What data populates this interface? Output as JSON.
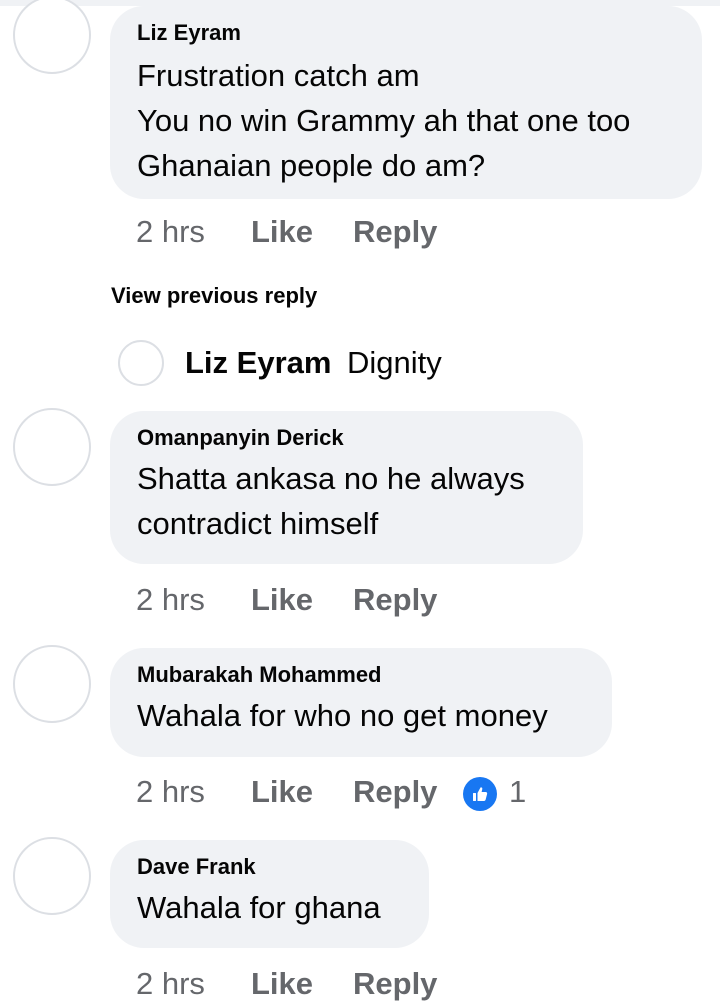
{
  "comments": [
    {
      "author": "Liz Eyram",
      "lines": [
        "Frustration catch am",
        "You no win Grammy ah that one too",
        "Ghanaian people do am?"
      ],
      "time": "2 hrs",
      "like_label": "Like",
      "reply_label": "Reply"
    },
    {
      "author": "Omanpanyin Derick",
      "lines": [
        "Shatta ankasa no he always",
        "contradict himself"
      ],
      "time": "2 hrs",
      "like_label": "Like",
      "reply_label": "Reply"
    },
    {
      "author": "Mubarakah Mohammed",
      "lines": [
        "Wahala for who no get money"
      ],
      "time": "2 hrs",
      "like_label": "Like",
      "reply_label": "Reply",
      "reaction_icon": "thumbs-up-icon",
      "reaction_count": "1"
    },
    {
      "author": "Dave Frank",
      "lines": [
        "Wahala for ghana"
      ],
      "time": "2 hrs",
      "like_label": "Like",
      "reply_label": "Reply"
    }
  ],
  "view_previous_reply": "View previous reply",
  "reply_preview": {
    "author": "Liz Eyram",
    "text": "Dignity"
  },
  "colors": {
    "bubble_bg": "#f0f2f5",
    "meta_text": "#65676b",
    "like_blue": "#1877f2"
  }
}
